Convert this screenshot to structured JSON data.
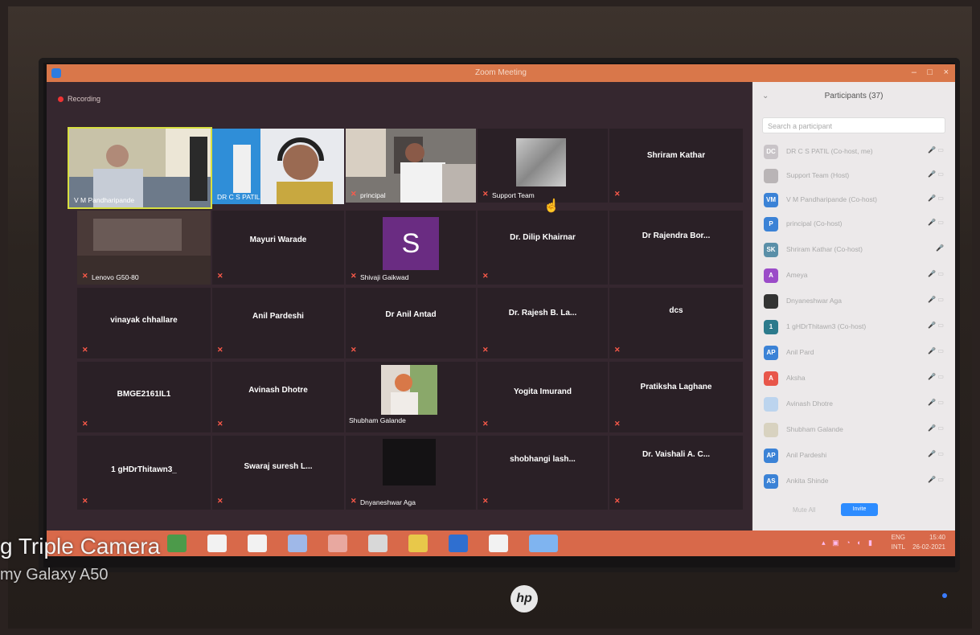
{
  "window": {
    "title": "Zoom Meeting",
    "controls": [
      "–",
      "□",
      "×"
    ]
  },
  "meeting": {
    "recording_label": "Recording",
    "video_tiles": [
      {
        "name": "V M Pandharipande",
        "active_speaker": true
      },
      {
        "name": "DR C S PATIL"
      },
      {
        "name": "principal"
      }
    ],
    "support_team": "Support Team",
    "name_tiles": [
      "Shriram Kathar",
      "Lenovo G50-80",
      "Mayuri Warade",
      "Shivaji Gaikwad",
      "Dr. Dilip Khairnar",
      "Dr Rajendra Bor...",
      "vinayak chhallare",
      "Anil Pardeshi",
      "Dr Anil Antad",
      "Dr. Rajesh B. La...",
      "dcs",
      "BMGE2161IL1",
      "Avinash Dhotre",
      "Shubham Galande",
      "Yogita Imurand",
      "Pratiksha Laghane",
      "1 gHDrThitawn3_",
      "Swaraj suresh L...",
      "Dnyaneshwar Aga",
      "shobhangi lash...",
      "Dr. Vaishali A. C..."
    ],
    "avatar_letter": "S"
  },
  "participants_panel": {
    "title": "Participants (37)",
    "search_placeholder": "Search a participant",
    "rows": [
      {
        "initials": "DC",
        "name": "DR C S PATIL (Co-host, me)",
        "color": "#c9c4c8"
      },
      {
        "initials": "",
        "name": "Support Team (Host)",
        "color": "#b9b4b6"
      },
      {
        "initials": "VM",
        "name": "V M Pandharipande (Co-host)",
        "color": "#3b82d6"
      },
      {
        "initials": "P",
        "name": "principal (Co-host)",
        "color": "#3b82d6"
      },
      {
        "initials": "SK",
        "name": "Shriram Kathar (Co-host)",
        "color": "#5a8fa8"
      },
      {
        "initials": "A",
        "name": "Ameya",
        "color": "#9b4bc8"
      },
      {
        "initials": "",
        "name": "Dnyaneshwar Aga",
        "color": "#333333"
      },
      {
        "initials": "1",
        "name": "1 gHDrThitawn3 (Co-host)",
        "color": "#2c7a8c"
      },
      {
        "initials": "AP",
        "name": "Anil Pard",
        "color": "#3b82d6"
      },
      {
        "initials": "A",
        "name": "Aksha",
        "color": "#e8564a"
      },
      {
        "initials": "",
        "name": "Avinash Dhotre",
        "color": "#bcd4ee"
      },
      {
        "initials": "",
        "name": "Shubham Galande",
        "color": "#d8d2c0"
      },
      {
        "initials": "AP",
        "name": "Anil Pardeshi",
        "color": "#3b82d6"
      },
      {
        "initials": "AS",
        "name": "Ankita Shinde",
        "color": "#3b82d6"
      }
    ],
    "mute_all": "Mute All",
    "invite": "Invite"
  },
  "taskbar": {
    "language": "ENG",
    "language_sub": "INTL",
    "time": "15:40",
    "date": "26-02-2021",
    "icon_colors": [
      "#4c9a4a",
      "#f2f2f2",
      "#f2f2f2",
      "#9fb8e8",
      "#e8a8a0",
      "#d8d8d8",
      "#e8c84a",
      "#2f6fd0",
      "#f2f2f2",
      "#7fb4f0"
    ]
  },
  "camera_watermark": {
    "line1": "g Triple Camera",
    "line2": "my Galaxy A50"
  },
  "monitor_brand": "hp"
}
